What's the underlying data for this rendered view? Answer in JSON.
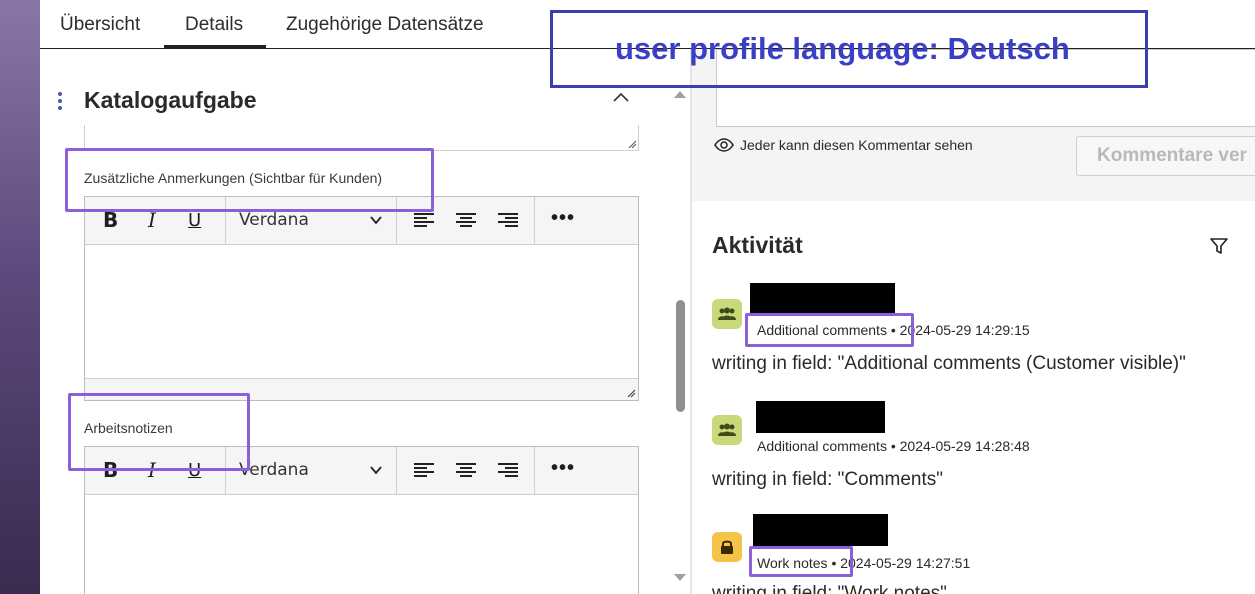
{
  "tabs": [
    {
      "label": "Übersicht"
    },
    {
      "label": "Details"
    },
    {
      "label": "Zugehörige Datensätze"
    }
  ],
  "active_tab": "Details",
  "section": {
    "title": "Katalogaufgabe"
  },
  "fields": {
    "additional_comments": {
      "label": "Zusätzliche Anmerkungen (Sichtbar für Kunden)"
    },
    "work_notes": {
      "label": "Arbeitsnotizen"
    }
  },
  "toolbar": {
    "bold": "B",
    "italic": "I",
    "underline": "U",
    "font": "Verdana",
    "more": "•••"
  },
  "compose": {
    "visibility_text": "Jeder kann diesen Kommentar sehen",
    "post_button": "Kommentare ver"
  },
  "activity": {
    "title": "Aktivität",
    "entries": [
      {
        "type": "Additional comments",
        "separator": "•",
        "timestamp": "2024-05-29 14:29:15",
        "text": "writing in field: \"Additional comments (Customer visible)\"",
        "icon": "group-icon"
      },
      {
        "type": "Additional comments",
        "separator": "•",
        "timestamp": "2024-05-29 14:28:48",
        "text": "writing in field: \"Comments\"",
        "icon": "group-icon"
      },
      {
        "type": "Work notes",
        "separator": "•",
        "timestamp": "2024-05-29 14:27:51",
        "text": "writing in field: \"Work notes\"",
        "icon": "lock-icon"
      }
    ]
  },
  "banner": {
    "text": "user profile language: Deutsch"
  },
  "colors": {
    "highlight": "#8b5fd6",
    "banner_border": "#3a3fb0",
    "banner_text": "#3a3fc8",
    "avatar_green": "#c9d97a",
    "avatar_yellow": "#f5c24a"
  }
}
